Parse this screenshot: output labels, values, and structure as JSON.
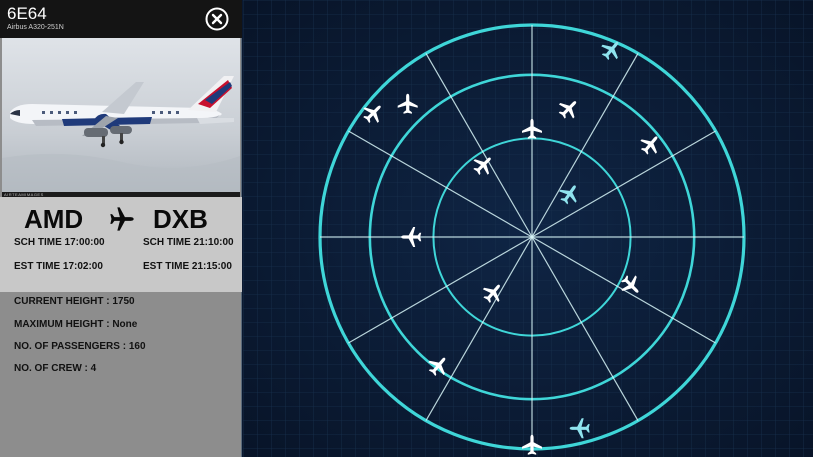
{
  "flight": {
    "code": "6E64",
    "aircraft_model": "Airbus A320-251N",
    "photo_caption": "AIRTEAMIMAGES"
  },
  "route": {
    "origin": "AMD",
    "destination": "DXB",
    "sch_departure": "SCH TIME 17:00:00",
    "sch_arrival": "SCH TIME 21:10:00",
    "est_departure": "EST TIME 17:02:00",
    "est_arrival": "EST TIME 21:15:00"
  },
  "details": {
    "current_height": "CURRENT HEIGHT : 1750",
    "maximum_height": "MAXIMUM HEIGHT : None",
    "passengers": "NO. OF PASSENGERS : 160",
    "crew": "NO. OF CREW : 4"
  },
  "icons": {
    "close": "close-circle-icon",
    "route": "airplane-icon",
    "radar_aircraft": "airplane-icon"
  },
  "colors": {
    "radar_background": "#0a1830",
    "radar_lines": "#3fd6d8",
    "aircraft_default": "#ffffff",
    "aircraft_highlight": "#8fe3ee",
    "panel_background": "#8d8d8d",
    "route_background": "#c8c8c8",
    "header_background": "#141414"
  },
  "radar": {
    "aircraft": [
      {
        "angle": 23,
        "radius": 0.96,
        "rotation": 40,
        "highlighted": true
      },
      {
        "angle": -52,
        "radius": 0.95,
        "rotation": 45,
        "highlighted": false
      },
      {
        "angle": -43,
        "radius": 0.86,
        "rotation": 0,
        "highlighted": false
      },
      {
        "angle": 16,
        "radius": 0.63,
        "rotation": 45,
        "highlighted": false
      },
      {
        "angle": 52,
        "radius": 0.71,
        "rotation": 40,
        "highlighted": false
      },
      {
        "angle": 0,
        "radius": 0.51,
        "rotation": 0,
        "highlighted": false
      },
      {
        "angle": -34,
        "radius": 0.41,
        "rotation": 45,
        "highlighted": false
      },
      {
        "angle": 41,
        "radius": 0.27,
        "rotation": 35,
        "highlighted": true
      },
      {
        "angle": -90,
        "radius": 0.57,
        "rotation": -90,
        "highlighted": false
      },
      {
        "angle": -145,
        "radius": 0.32,
        "rotation": 40,
        "highlighted": false
      },
      {
        "angle": 116,
        "radius": 0.52,
        "rotation": 135,
        "highlighted": false
      },
      {
        "angle": -144,
        "radius": 0.75,
        "rotation": 40,
        "highlighted": false
      },
      {
        "angle": 166,
        "radius": 0.93,
        "rotation": -90,
        "highlighted": true
      },
      {
        "angle": 180,
        "radius": 0.98,
        "rotation": 0,
        "highlighted": false
      }
    ]
  }
}
